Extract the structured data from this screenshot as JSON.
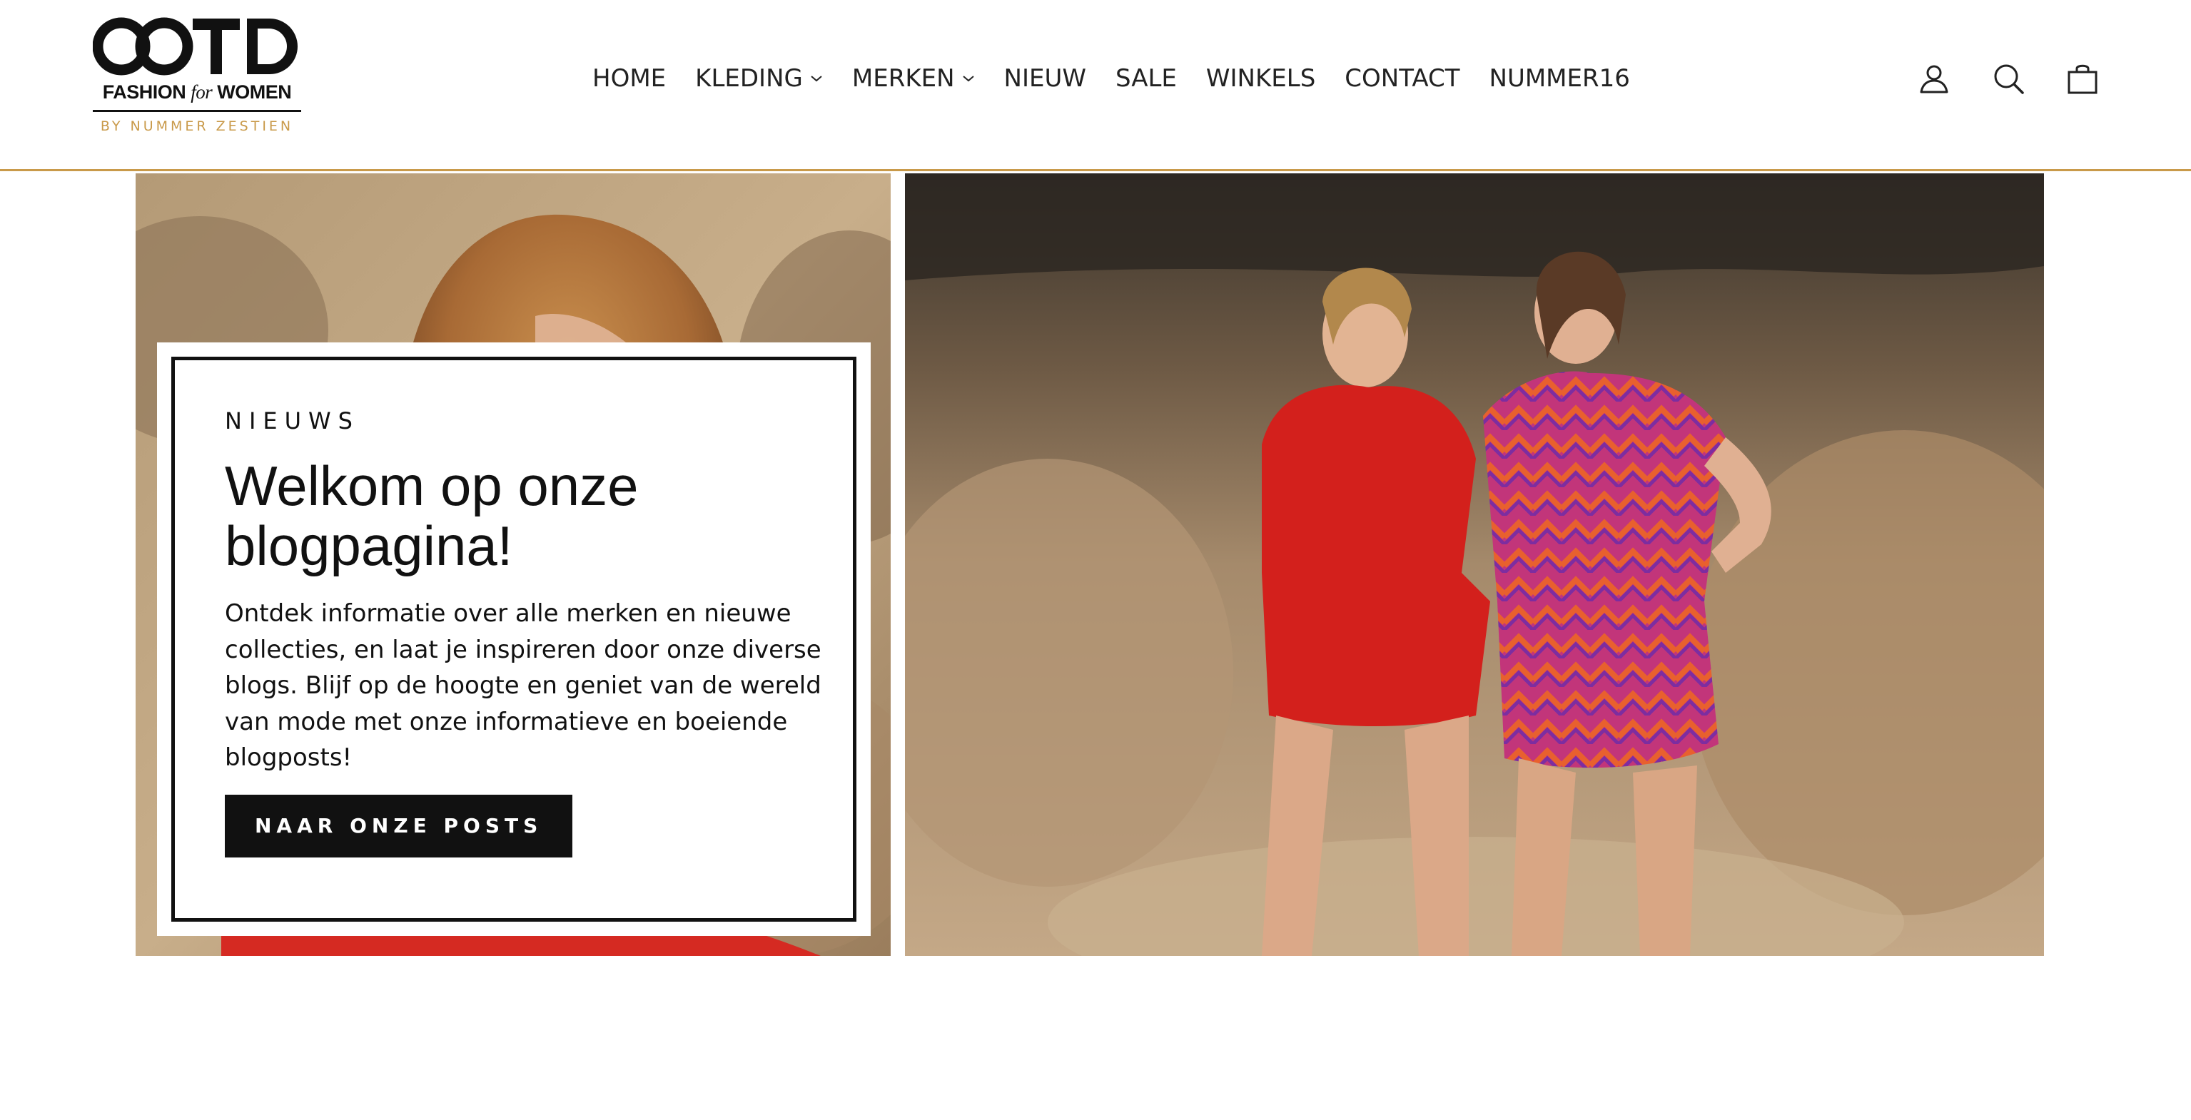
{
  "brand": {
    "logo_mark": "OOTD",
    "logo_line_bold_1": "FASHION",
    "logo_line_italic": "for",
    "logo_line_bold_2": "WOMEN",
    "byline": "BY NUMMER ZESTIEN",
    "accent_color": "#c99a4a"
  },
  "nav": {
    "items": [
      {
        "label": "HOME",
        "dropdown": false
      },
      {
        "label": "KLEDING",
        "dropdown": true
      },
      {
        "label": "MERKEN",
        "dropdown": true
      },
      {
        "label": "NIEUW",
        "dropdown": false
      },
      {
        "label": "SALE",
        "dropdown": false
      },
      {
        "label": "WINKELS",
        "dropdown": false
      },
      {
        "label": "CONTACT",
        "dropdown": false
      },
      {
        "label": "NUMMER16",
        "dropdown": false
      }
    ]
  },
  "utility": {
    "icons": [
      "user-icon",
      "search-icon",
      "bag-icon"
    ]
  },
  "hero": {
    "left_image": "woman-with-bob-hair-red-top-photo",
    "right_image": "two-women-red-jumpsuit-and-printed-dress-on-rocks-photo"
  },
  "card": {
    "eyebrow": "NIEUWS",
    "title": "Welkom op onze blogpagina!",
    "body": "Ontdek informatie over alle merken en nieuwe collecties, en laat je inspireren door onze diverse blogs. Blijf op de hoogte en geniet van de wereld van mode met onze informatieve en boeiende blogposts!",
    "cta_label": "NAAR ONZE POSTS"
  }
}
